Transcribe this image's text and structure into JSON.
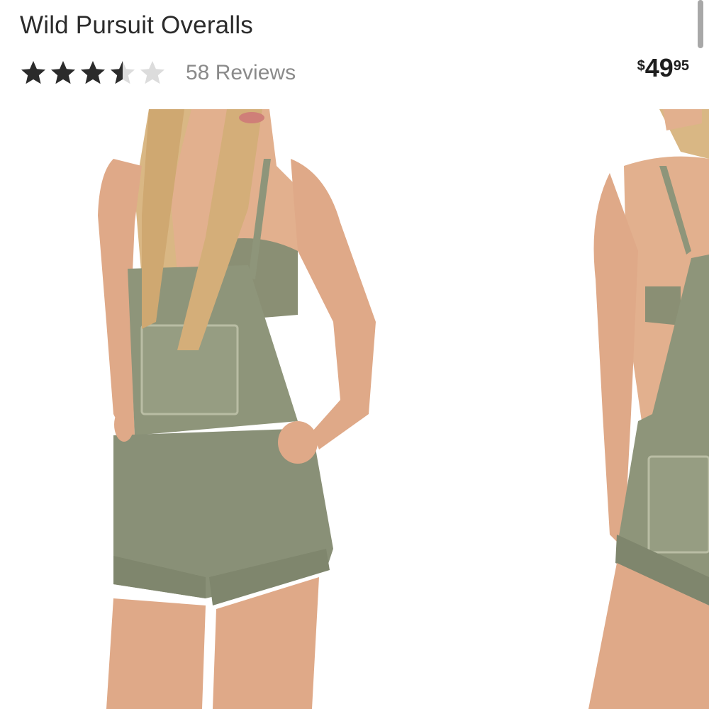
{
  "product": {
    "title": "Wild Pursuit Overalls",
    "rating": 3.5,
    "rating_max": 5,
    "reviews_label": "58 Reviews",
    "price": {
      "symbol": "$",
      "dollars": "49",
      "cents": "95"
    }
  },
  "icons": {
    "star_filled": "star-filled-icon",
    "star_half": "star-half-icon",
    "star_empty": "star-empty-icon"
  },
  "colors": {
    "star_filled": "#2b2b2b",
    "star_empty": "#dcdcdc",
    "text": "#2b2b2b",
    "muted": "#8a8a8a",
    "overalls": "#8e957a",
    "skin": "#e3b493"
  }
}
